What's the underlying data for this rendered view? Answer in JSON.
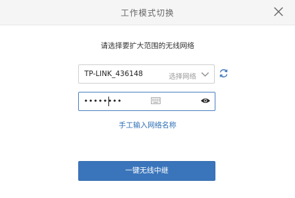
{
  "dialog": {
    "title": "工作模式切换",
    "subtitle": "请选择要扩大范围的无线网络"
  },
  "network_select": {
    "value": "TP-LINK_436148",
    "hint": "选择网络"
  },
  "password_field": {
    "value": "••••••••"
  },
  "manual_link": "手工输入网络名称",
  "primary_button": "一键无线中继",
  "colors": {
    "accent": "#3a75bb",
    "link": "#2f6fb5",
    "title_bar": "#f5f5f5"
  },
  "icons": [
    "close-icon",
    "chevron-down-icon",
    "refresh-icon",
    "keyboard-icon",
    "eye-icon"
  ]
}
